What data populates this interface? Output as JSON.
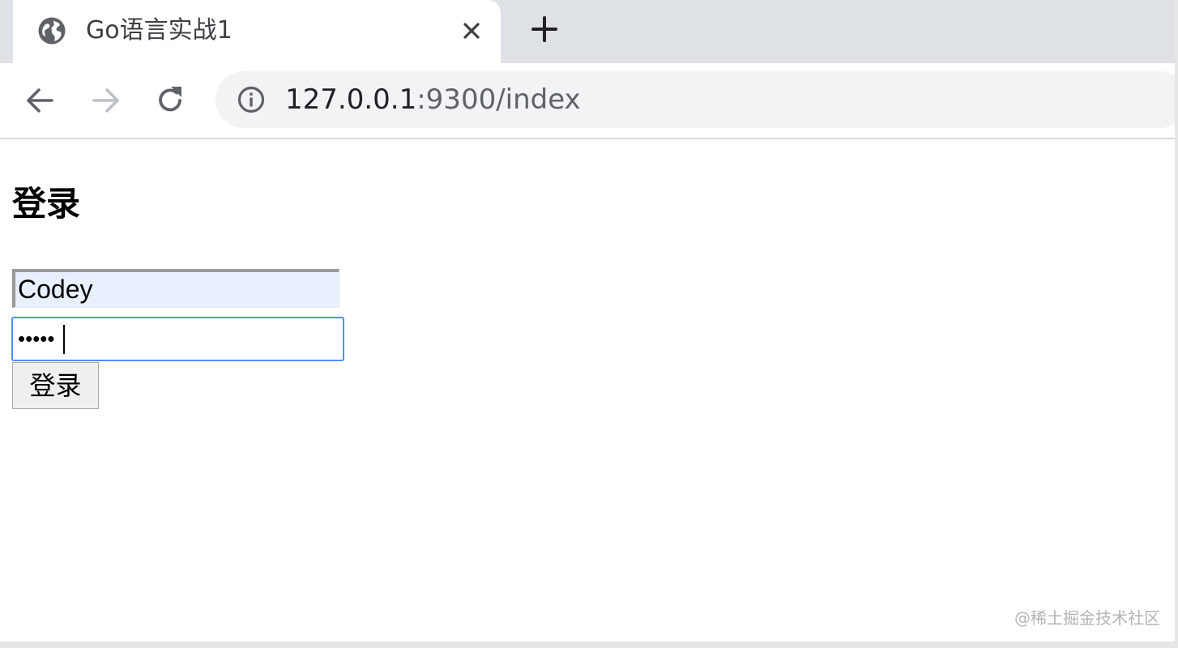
{
  "tab": {
    "title": "Go语言实战1",
    "favicon": "globe-icon"
  },
  "toolbar": {
    "url_host": "127.0.0.1",
    "url_rest": ":9300/index"
  },
  "page": {
    "heading": "登录",
    "username_value": "Codey",
    "password_mask": "•••••",
    "submit_label": "登录"
  },
  "watermark": "@稀土掘金技术社区",
  "colors": {
    "tabstrip": "#dee1e6",
    "omnibox": "#f1f3f4",
    "autofill": "#e8f0fe",
    "focus": "#4d90fe"
  }
}
